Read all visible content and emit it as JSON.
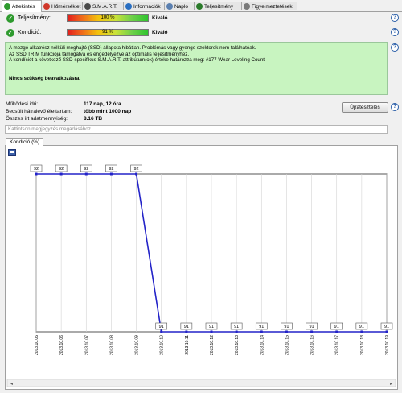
{
  "tabs": [
    {
      "label": "Áttekintés",
      "icon": "overview-icon",
      "color": "#2e9a2e",
      "active": true
    },
    {
      "label": "Hőmérséklet",
      "icon": "temperature-icon",
      "color": "#d0372a",
      "active": false
    },
    {
      "label": "S.M.A.R.T.",
      "icon": "smart-icon",
      "color": "#4a4a4a",
      "active": false
    },
    {
      "label": "Információk",
      "icon": "info-icon",
      "color": "#2a6fc2",
      "active": false
    },
    {
      "label": "Napló",
      "icon": "log-icon",
      "color": "#5a7fb0",
      "active": false
    },
    {
      "label": "Teljesítmény",
      "icon": "performance-icon",
      "color": "#2a7a2a",
      "active": false
    },
    {
      "label": "Figyelmeztetések",
      "icon": "alerts-icon",
      "color": "#7a7a7a",
      "active": false
    }
  ],
  "metrics": [
    {
      "label": "Teljesítmény:",
      "value_text": "100 %",
      "value": 100,
      "status": "Kiváló"
    },
    {
      "label": "Kondíció:",
      "value_text": "91 %",
      "value": 91,
      "status": "Kiváló"
    }
  ],
  "message": {
    "lines": [
      "A mozgó alkatrész nélküli meghajtó (SSD) állapota hibátlan. Problémás vagy gyenge szektorok nem találhatóak.",
      "Az SSD TRIM funkciója támogatva és engedélyezve az optimális teljesítményhez.",
      "A kondíciót a következő SSD-specifikus S.M.A.R.T. attribútum(ok) értéke határozza meg:  #177 Wear Leveling Count"
    ],
    "bold_line": "Nincs szükség beavatkozásra."
  },
  "stats": [
    {
      "label": "Működési idő:",
      "value": "117 nap, 12 óra"
    },
    {
      "label": "Becsült hátralévő élettartam:",
      "value": "több mint 1000 nap"
    },
    {
      "label": "Összes írt adatmennyiség:",
      "value": "8.16 TB"
    }
  ],
  "reset_button": "Újratesztelés",
  "comment_placeholder": "Kattintson megjegyzés megadásához ...",
  "chart_tab": "Kondíció  (%)",
  "save_icon": "save-icon",
  "chart_data": {
    "type": "line",
    "x": [
      "2013.10.05",
      "2013.10.06",
      "2013.10.07",
      "2013.10.08",
      "2013.10.09",
      "2013.10.10",
      "2013.10.11",
      "2013.10.12",
      "2013.10.13",
      "2013.10.14",
      "2013.10.15",
      "2013.10.16",
      "2013.10.17",
      "2013.10.18",
      "2013.10.19"
    ],
    "series": [
      {
        "values": [
          92,
          92,
          92,
          92,
          92,
          91,
          91,
          91,
          91,
          91,
          91,
          91,
          91,
          91,
          91
        ]
      }
    ],
    "color": "#2323c8",
    "grid": true,
    "title": "",
    "xlabel": "",
    "ylabel": ""
  }
}
